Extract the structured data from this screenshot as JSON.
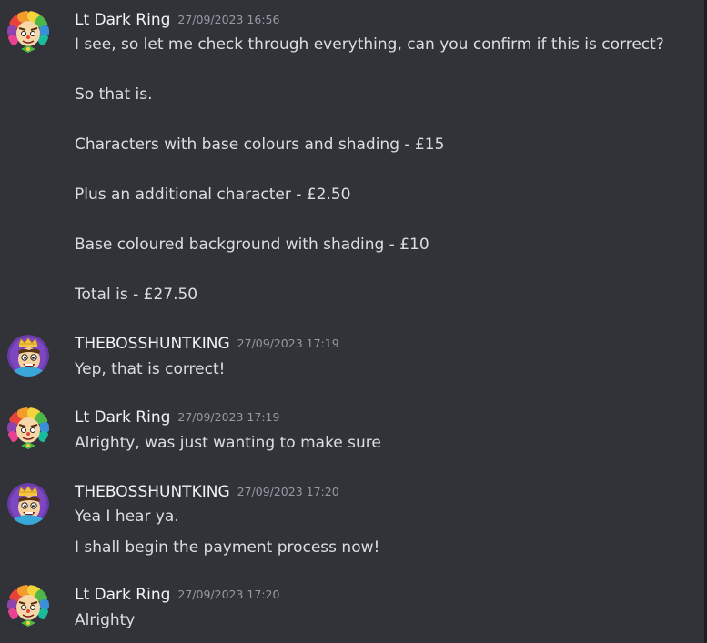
{
  "messages": [
    {
      "author": "Lt Dark Ring",
      "timestamp": "27/09/2023 16:56",
      "lines": [
        "I see, so let me check through everything, can you confirm if this is correct?",
        "So that is.",
        "Characters with base colours and shading - £15",
        "Plus an additional character - £2.50",
        "Base coloured background with shading - £10",
        "Total is - £27.50"
      ]
    },
    {
      "author": "THEBOSSHUNTKING",
      "timestamp": "27/09/2023 17:19",
      "lines": [
        "Yep, that is correct!"
      ]
    },
    {
      "author": "Lt Dark Ring",
      "timestamp": "27/09/2023 17:19",
      "lines": [
        "Alrighty, was just wanting to make sure"
      ]
    },
    {
      "author": "THEBOSSHUNTKING",
      "timestamp": "27/09/2023 17:20",
      "lines": [
        "Yea I hear ya.",
        "I shall begin the payment process now!"
      ]
    },
    {
      "author": "Lt Dark Ring",
      "timestamp": "27/09/2023 17:20",
      "lines": [
        "Alrighty"
      ]
    }
  ],
  "colors": {
    "background": "#313338",
    "username": "#f2f3f5",
    "text": "#dbdee1",
    "timestamp": "#949ba4"
  },
  "avatars": {
    "lt_dark_ring": "clown-avatar-icon",
    "thebosshuntking": "king-avatar-icon"
  }
}
